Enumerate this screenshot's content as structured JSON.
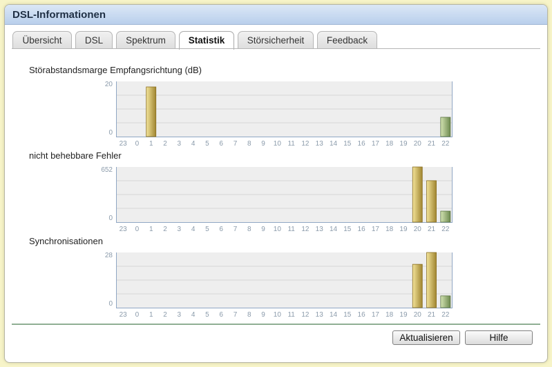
{
  "window": {
    "title": "DSL-Informationen"
  },
  "tabs": [
    {
      "label": "Übersicht"
    },
    {
      "label": "DSL"
    },
    {
      "label": "Spektrum"
    },
    {
      "label": "Statistik",
      "active": true
    },
    {
      "label": "Störsicherheit"
    },
    {
      "label": "Feedback"
    }
  ],
  "colors": {
    "bar_gold_light": "#f3e49a",
    "bar_gold_dark": "#a08530",
    "bar_green_light": "#d3e3b2",
    "bar_green_dark": "#6d8a4f",
    "plot_bg": "#eeeeee",
    "axis_color": "#8fa6c4",
    "tick_label_color": "#8a9aaa"
  },
  "chart_data": [
    {
      "type": "bar",
      "title": "Störabstandsmarge Empfangsrichtung (dB)",
      "categories": [
        "23",
        "0",
        "1",
        "2",
        "3",
        "4",
        "5",
        "6",
        "7",
        "8",
        "9",
        "10",
        "11",
        "12",
        "13",
        "14",
        "15",
        "16",
        "17",
        "18",
        "19",
        "20",
        "21",
        "22"
      ],
      "values": [
        0,
        0,
        18,
        0,
        0,
        0,
        0,
        0,
        0,
        0,
        0,
        0,
        0,
        0,
        0,
        0,
        0,
        0,
        0,
        0,
        0,
        0,
        0,
        7
      ],
      "highlight_index": 23,
      "ylim": [
        0,
        20
      ],
      "y_ticks": [
        "20",
        "0"
      ],
      "grid": true
    },
    {
      "type": "bar",
      "title": "nicht behebbare Fehler",
      "categories": [
        "23",
        "0",
        "1",
        "2",
        "3",
        "4",
        "5",
        "6",
        "7",
        "8",
        "9",
        "10",
        "11",
        "12",
        "13",
        "14",
        "15",
        "16",
        "17",
        "18",
        "19",
        "20",
        "21",
        "22"
      ],
      "values": [
        0,
        0,
        0,
        0,
        0,
        0,
        0,
        0,
        0,
        0,
        0,
        0,
        0,
        0,
        0,
        0,
        0,
        0,
        0,
        0,
        0,
        652,
        490,
        130
      ],
      "highlight_index": 23,
      "ylim": [
        0,
        652
      ],
      "y_ticks": [
        "652",
        "0"
      ],
      "grid": true
    },
    {
      "type": "bar",
      "title": "Synchronisationen",
      "categories": [
        "23",
        "0",
        "1",
        "2",
        "3",
        "4",
        "5",
        "6",
        "7",
        "8",
        "9",
        "10",
        "11",
        "12",
        "13",
        "14",
        "15",
        "16",
        "17",
        "18",
        "19",
        "20",
        "21",
        "22"
      ],
      "values": [
        0,
        0,
        0,
        0,
        0,
        0,
        0,
        0,
        0,
        0,
        0,
        0,
        0,
        0,
        0,
        0,
        0,
        0,
        0,
        0,
        0,
        22,
        28,
        6
      ],
      "highlight_index": 23,
      "ylim": [
        0,
        28
      ],
      "y_ticks": [
        "28",
        "0"
      ],
      "grid": true
    }
  ],
  "buttons": {
    "refresh": "Aktualisieren",
    "help": "Hilfe"
  }
}
